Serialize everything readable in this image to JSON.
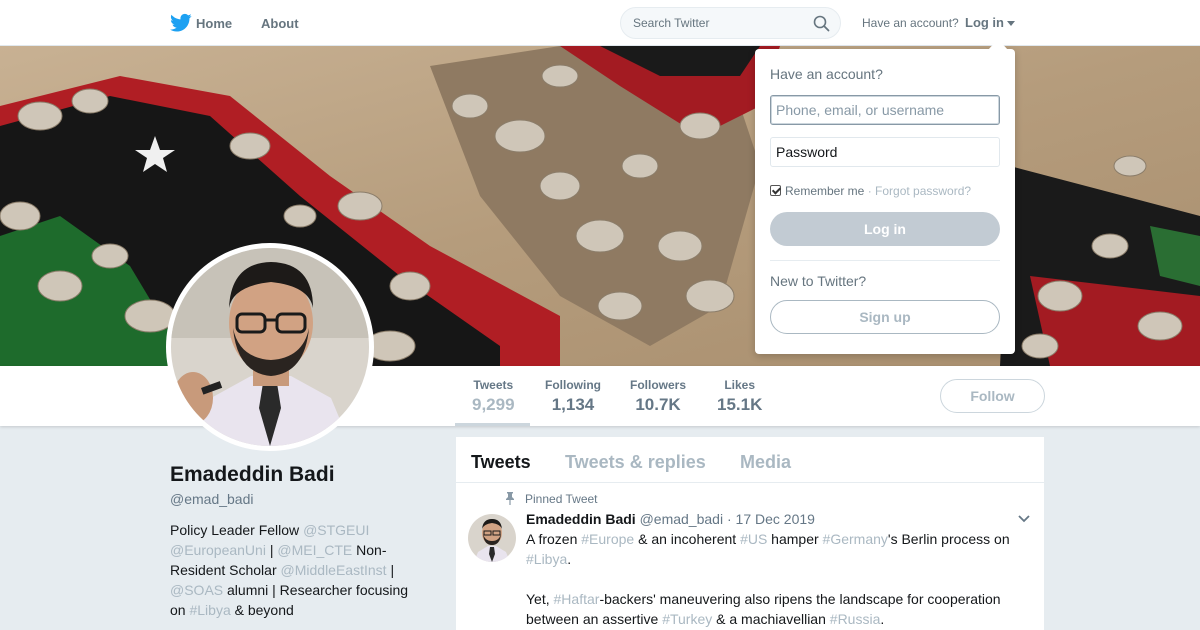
{
  "nav": {
    "home_label": "Home",
    "about_label": "About",
    "search_placeholder": "Search Twitter",
    "have_account": "Have an account?",
    "login_label": "Log in"
  },
  "colors": {
    "accent": "#1da1f2",
    "muted": "#657786",
    "link_muted": "#aab8c2",
    "background": "#e6ecf0"
  },
  "profile": {
    "name": "Emadeddin Badi",
    "handle": "@emad_badi",
    "bio": [
      {
        "text": "Policy Leader Fellow ",
        "mention": false
      },
      {
        "text": "@STGEUI",
        "mention": true
      },
      {
        "text": " ",
        "mention": false
      },
      {
        "text": "@EuropeanUni",
        "mention": true
      },
      {
        "text": " | ",
        "mention": false
      },
      {
        "text": "@MEI_CTE",
        "mention": true
      },
      {
        "text": " Non-Resident Scholar ",
        "mention": false
      },
      {
        "text": "@MiddleEastInst",
        "mention": true
      },
      {
        "text": " | ",
        "mention": false
      },
      {
        "text": "@SOAS",
        "mention": true
      },
      {
        "text": " alumni | Researcher focusing on ",
        "mention": false
      },
      {
        "text": "#Libya",
        "mention": true
      },
      {
        "text": " & beyond",
        "mention": false
      }
    ]
  },
  "stats": [
    {
      "label": "Tweets",
      "value": "9,299"
    },
    {
      "label": "Following",
      "value": "1,134"
    },
    {
      "label": "Followers",
      "value": "10.7K"
    },
    {
      "label": "Likes",
      "value": "15.1K"
    }
  ],
  "follow_label": "Follow",
  "timeline": {
    "tabs": [
      "Tweets",
      "Tweets & replies",
      "Media"
    ],
    "pinned_label": "Pinned Tweet",
    "tweet": {
      "name": "Emadeddin Badi",
      "handle": "@emad_badi",
      "separator": " · ",
      "date": "17 Dec 2019",
      "paragraph1": [
        {
          "text": "A frozen ",
          "tag": false
        },
        {
          "text": "#Europe",
          "tag": true
        },
        {
          "text": " & an incoherent ",
          "tag": false
        },
        {
          "text": "#US",
          "tag": true
        },
        {
          "text": " hamper ",
          "tag": false
        },
        {
          "text": "#Germany",
          "tag": true
        },
        {
          "text": "'s Berlin process on ",
          "tag": false
        },
        {
          "text": "#Libya",
          "tag": true
        },
        {
          "text": ".",
          "tag": false
        }
      ],
      "paragraph2": [
        {
          "text": "Yet, ",
          "tag": false
        },
        {
          "text": "#Haftar",
          "tag": true
        },
        {
          "text": "-backers' maneuvering also ripens the landscape for cooperation between an assertive ",
          "tag": false
        },
        {
          "text": "#Turkey",
          "tag": true
        },
        {
          "text": " & a machiavellian ",
          "tag": false
        },
        {
          "text": "#Russia",
          "tag": true
        },
        {
          "text": ".",
          "tag": false
        }
      ]
    }
  },
  "login_dropdown": {
    "title": "Have an account?",
    "username_placeholder": "Phone, email, or username",
    "password_placeholder": "Password",
    "remember_label": "Remember me",
    "forgot_separator": " · ",
    "forgot_label": "Forgot password?",
    "login_button": "Log in",
    "new_label": "New to Twitter?",
    "signup_button": "Sign up"
  }
}
